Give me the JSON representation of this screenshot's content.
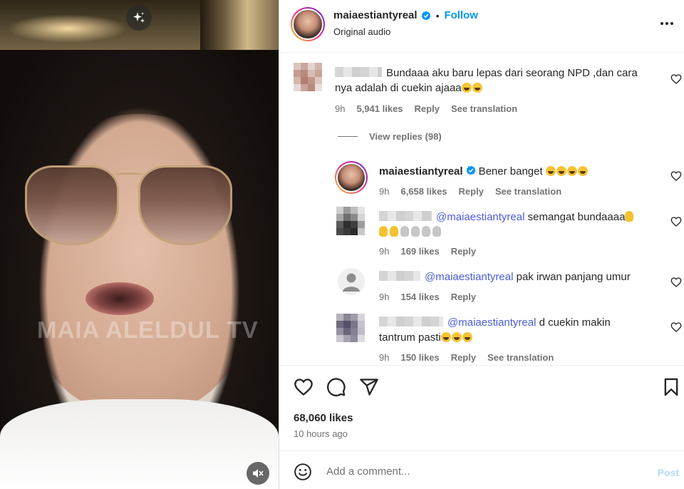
{
  "video": {
    "watermark": "MAIA ALELDUL TV",
    "icons": {
      "sparkle": "sparkle-icon",
      "mute": "muted-speaker-icon"
    }
  },
  "header": {
    "username": "maiaestiantyreal",
    "separator": "•",
    "follow_label": "Follow",
    "audio": "Original audio",
    "more": "more-options-icon"
  },
  "comments": [
    {
      "text": "Bundaaa aku baru lepas dari seorang NPD ,dan cara nya adalah di cuekin ajaaa",
      "time": "9h",
      "likes": "5,941 likes",
      "reply": "Reply",
      "translation": "See translation"
    }
  ],
  "view_replies": "View replies (98)",
  "replies": [
    {
      "username": "maiaestiantyreal",
      "text": "Bener banget",
      "time": "9h",
      "likes": "6,658 likes",
      "reply": "Reply",
      "translation": "See translation"
    },
    {
      "mention": "@maiaestiantyreal",
      "text": "semangat bundaaaa",
      "time": "9h",
      "likes": "169 likes",
      "reply": "Reply"
    },
    {
      "mention": "@maiaestiantyreal",
      "text": "pak irwan panjang umur",
      "time": "9h",
      "likes": "154 likes",
      "reply": "Reply"
    },
    {
      "mention": "@maiaestiantyreal",
      "text_line1": "d cuekin makin",
      "text_line2": "tantrum pasti",
      "time": "9h",
      "likes": "150 likes",
      "reply": "Reply",
      "translation": "See translation"
    }
  ],
  "post": {
    "likes": "68,060 likes",
    "time_ago": "10 hours ago"
  },
  "comment_box": {
    "placeholder": "Add a comment...",
    "post_label": "Post"
  },
  "colors": {
    "link_blue": "#0095f6",
    "mention": "#4a5cd9",
    "muted": "#737373",
    "post_disabled": "#b3dbff"
  }
}
